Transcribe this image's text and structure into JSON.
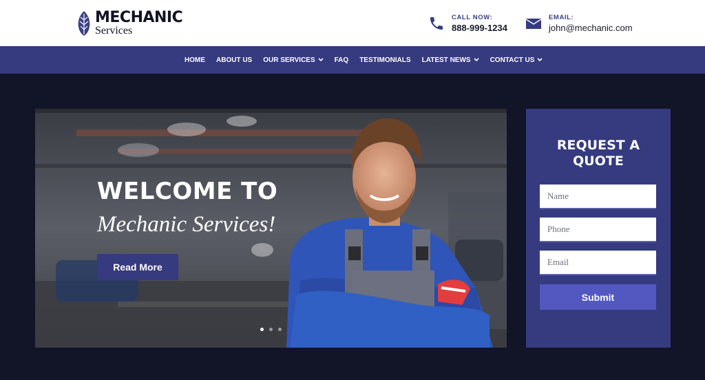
{
  "header": {
    "logo": {
      "main": "MECHANIC",
      "sub": "Services"
    },
    "phone": {
      "label": "CALL NOW:",
      "value": "888-999-1234",
      "icon": "phone-icon"
    },
    "email": {
      "label": "EMAIL:",
      "value": "john@mechanic.com",
      "icon": "envelope-icon"
    }
  },
  "nav": {
    "items": [
      {
        "label": "HOME"
      },
      {
        "label": "ABOUT US"
      },
      {
        "label": "OUR SERVICES"
      },
      {
        "label": "FAQ"
      },
      {
        "label": "TESTIMONIALS"
      },
      {
        "label": "LATEST NEWS"
      },
      {
        "label": "CONTACT US"
      }
    ]
  },
  "hero": {
    "title": "WELCOME TO",
    "subtitle": "Mechanic Services!",
    "button": "Read More",
    "slides": 3,
    "active_slide": 1
  },
  "quote": {
    "title": "REQUEST A\nQUOTE",
    "fields": {
      "name": "Name",
      "phone": "Phone",
      "email": "Email"
    },
    "submit": "Submit"
  },
  "colors": {
    "accent": "#363a7e",
    "page_bg": "#121428",
    "button": "#5258c0"
  }
}
